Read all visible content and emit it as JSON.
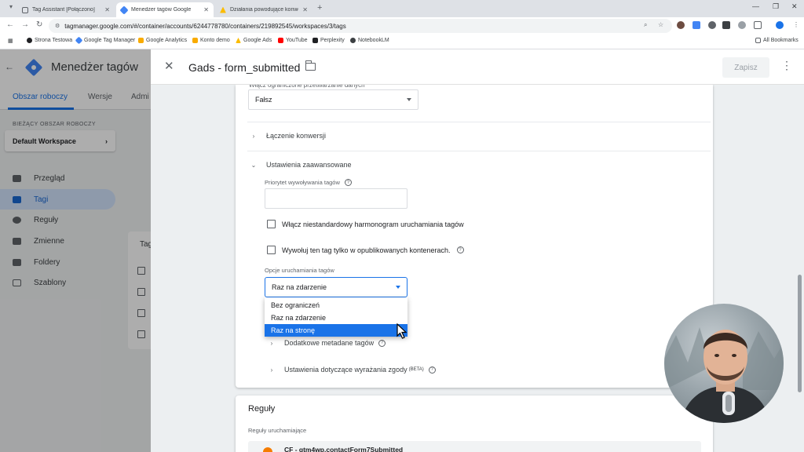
{
  "browser": {
    "tabs": [
      {
        "title": "Tag Assistant [Połączono]",
        "color": "#5f6368"
      },
      {
        "title": "Menedżer tagów Google",
        "color": "#4285f4"
      },
      {
        "title": "Działania powodujące konwersję",
        "color": "#fbbc04"
      }
    ],
    "url": "tagmanager.google.com/#/container/accounts/6244778780/containers/219892545/workspaces/3/tags",
    "bookmarks": [
      "Strona Testowa",
      "Google Tag Manager",
      "Google Analytics",
      "Konto demo",
      "Google Ads",
      "YouTube",
      "Perplexity",
      "NotebookLM"
    ],
    "all_bookmarks": "All Bookmarks"
  },
  "gtm": {
    "title": "Menedżer tagów",
    "tabs": [
      "Obszar roboczy",
      "Wersje",
      "Admi"
    ],
    "workspace_label": "BIEŻĄCY OBSZAR ROBOCZY",
    "workspace_name": "Default Workspace",
    "nav": [
      "Przegląd",
      "Tagi",
      "Reguły",
      "Zmienne",
      "Foldery",
      "Szablony"
    ],
    "list_header": "Tag"
  },
  "sheet": {
    "title": "Gads - form_submitted",
    "save_label": "Zapisz",
    "cut_label": "Włącz ograniczone przetwarzanie danych",
    "restricted_value": "Fałsz",
    "conversion_linking": "Łączenie konwersji",
    "advanced_settings": "Ustawienia zaawansowane",
    "priority_label": "Priorytet wywoływania tagów",
    "custom_schedule": "Włącz niestandardowy harmonogram uruchamiania tagów",
    "published_only": "Wywołuj ten tag tylko w opublikowanych kontenerach.",
    "firing_options_label": "Opcje uruchamiania tagów",
    "firing_options_value": "Raz na zdarzenie",
    "firing_options": [
      "Bez ograniczeń",
      "Raz na zdarzenie",
      "Raz na stronę"
    ],
    "highlighted_option": "Raz na stronę",
    "additional_metadata": "Dodatkowe metadane tagów",
    "consent_settings": "Ustawienia dotyczące wyrażania zgody",
    "consent_badge": "(BETA)",
    "rules_title": "Reguły",
    "rules_sub": "Reguły uruchamiające",
    "trigger_name": "CF - gtm4wp.contactForm7Submitted"
  },
  "colors": {
    "accent": "#1a73e8",
    "trigger": "#f57c00"
  }
}
